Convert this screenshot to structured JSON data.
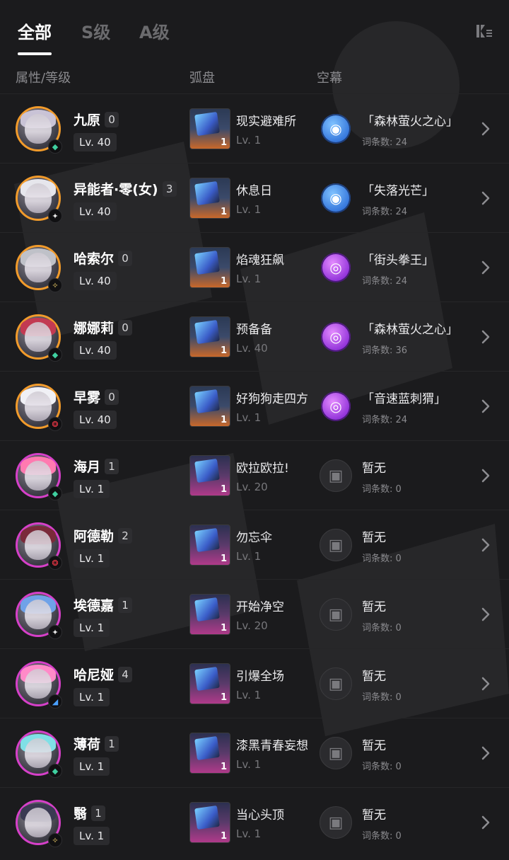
{
  "tabs": [
    {
      "label": "全部",
      "active": true
    },
    {
      "label": "S级",
      "active": false
    },
    {
      "label": "A级",
      "active": false
    }
  ],
  "columns": {
    "attr": "属性/等级",
    "disc": "弧盘",
    "screen": "空幕"
  },
  "rows": [
    {
      "name": "九原",
      "rank": "0",
      "lv": "Lv. 40",
      "tier": "S",
      "element": "wind",
      "disc_name": "现实避难所",
      "disc_lv": "Lv. 1",
      "disc_count": "1",
      "sc_name": "「森林萤火之心」",
      "sc_count": "词条数: 24",
      "sc_icon": "blue"
    },
    {
      "name": "异能者·零(女)",
      "rank": "3",
      "lv": "Lv. 40",
      "tier": "S",
      "element": "light",
      "disc_name": "休息日",
      "disc_lv": "Lv. 1",
      "disc_count": "1",
      "sc_name": "「失落光芒」",
      "sc_count": "词条数: 24",
      "sc_icon": "blue"
    },
    {
      "name": "哈索尔",
      "rank": "0",
      "lv": "Lv. 40",
      "tier": "S",
      "element": "star",
      "disc_name": "焰魂狂飙",
      "disc_lv": "Lv. 1",
      "disc_count": "1",
      "sc_name": "「街头拳王」",
      "sc_count": "词条数: 24",
      "sc_icon": "purple"
    },
    {
      "name": "娜娜莉",
      "rank": "0",
      "lv": "Lv. 40",
      "tier": "S",
      "element": "wind",
      "disc_name": "预备备",
      "disc_lv": "Lv. 40",
      "disc_count": "1",
      "sc_name": "「森林萤火之心」",
      "sc_count": "词条数: 36",
      "sc_icon": "purple"
    },
    {
      "name": "早雾",
      "rank": "0",
      "lv": "Lv. 40",
      "tier": "S",
      "element": "fire",
      "disc_name": "好狗狗走四方",
      "disc_lv": "Lv. 1",
      "disc_count": "1",
      "sc_name": "「音速蓝刺猬」",
      "sc_count": "词条数: 24",
      "sc_icon": "purple"
    },
    {
      "name": "海月",
      "rank": "1",
      "lv": "Lv. 1",
      "tier": "A",
      "element": "wind",
      "disc_name": "欧拉欧拉!",
      "disc_lv": "Lv. 20",
      "disc_count": "1",
      "sc_name": "暂无",
      "sc_count": "词条数: 0",
      "sc_icon": "none"
    },
    {
      "name": "阿德勒",
      "rank": "2",
      "lv": "Lv. 1",
      "tier": "A",
      "element": "fire",
      "disc_name": "勿忘伞",
      "disc_lv": "Lv. 1",
      "disc_count": "1",
      "sc_name": "暂无",
      "sc_count": "词条数: 0",
      "sc_icon": "none"
    },
    {
      "name": "埃德嘉",
      "rank": "1",
      "lv": "Lv. 1",
      "tier": "A",
      "element": "light",
      "disc_name": "开始净空",
      "disc_lv": "Lv. 20",
      "disc_count": "1",
      "sc_name": "暂无",
      "sc_count": "词条数: 0",
      "sc_icon": "none"
    },
    {
      "name": "哈尼娅",
      "rank": "4",
      "lv": "Lv. 1",
      "tier": "A",
      "element": "water",
      "disc_name": "引爆全场",
      "disc_lv": "Lv. 1",
      "disc_count": "1",
      "sc_name": "暂无",
      "sc_count": "词条数: 0",
      "sc_icon": "none"
    },
    {
      "name": "薄荷",
      "rank": "1",
      "lv": "Lv. 1",
      "tier": "A",
      "element": "wind",
      "disc_name": "漆黑青春妄想",
      "disc_lv": "Lv. 1",
      "disc_count": "1",
      "sc_name": "暂无",
      "sc_count": "词条数: 0",
      "sc_icon": "none"
    },
    {
      "name": "翳",
      "rank": "1",
      "lv": "Lv. 1",
      "tier": "A",
      "element": "star",
      "disc_name": "当心头顶",
      "disc_lv": "Lv. 1",
      "disc_count": "1",
      "sc_name": "暂无",
      "sc_count": "词条数: 0",
      "sc_icon": "none"
    }
  ],
  "colors": {
    "background": "#1b1b1d",
    "s_tier_border": "#f29b2b",
    "a_tier_border": "#d640c9",
    "screen_blue": "#2e6fd8",
    "screen_purple": "#8a2bd6"
  },
  "icons": {
    "filter": "filter-icon",
    "chevron": "chevron-right-icon",
    "element_wind": "wind-element-icon",
    "element_light": "light-element-icon",
    "element_star": "star-element-icon",
    "element_fire": "fire-element-icon",
    "element_water": "water-element-icon",
    "screen_empty": "empty-screen-icon"
  }
}
